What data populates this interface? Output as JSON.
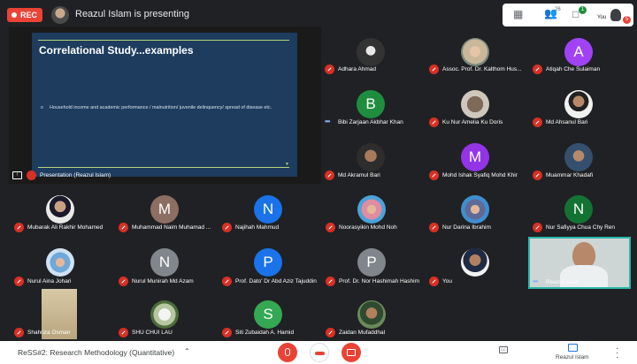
{
  "topbar": {
    "rec_label": "REC",
    "presenting_text": "Reazul Islam is presenting",
    "participants_count": "26",
    "chat_badge": "1",
    "you_label": "You",
    "alert_badge": "5"
  },
  "presentation": {
    "slide_title": "Correlational Study...examples",
    "slide_bullet": "o",
    "slide_body": "Household income and academic performance / malnutrition/ juvenile delinquency/ spread of disease etc.",
    "label": "Presentation (Reazul Islam)"
  },
  "participants": [
    {
      "name": "Adhara Ahmad"
    },
    {
      "name": "Assoc. Prof. Dr. Kalthom Hus..."
    },
    {
      "name": "Atiqah Che Sulaiman",
      "initial": "A"
    },
    {
      "name": "Bibi Zarjaan Akbhar Khan",
      "initial": "B"
    },
    {
      "name": "Ku Nur Amelia Ku Doris"
    },
    {
      "name": "Md Ahsanul Bari"
    },
    {
      "name": "Md Akramul Bari"
    },
    {
      "name": "Mohd Ishak Syafiq Mohd Khir",
      "initial": "M"
    },
    {
      "name": "Muammar Khadafi"
    },
    {
      "name": "Mubarak Ali Rakhir Mohamed"
    },
    {
      "name": "Muhammad Naim Muhamad ...",
      "initial": "M"
    },
    {
      "name": "Najihah Mahmud",
      "initial": "N"
    },
    {
      "name": "Noorasyikin Mohd Noh"
    },
    {
      "name": "Nur Darina Ibrahim"
    },
    {
      "name": "Nur Safiyya Chua Chy Ren",
      "initial": "N"
    },
    {
      "name": "Nurul Aina Johari"
    },
    {
      "name": "Nurul Munirah Md Azam",
      "initial": "N"
    },
    {
      "name": "Prof. Dato' Dr Abd Aziz Tajuddin",
      "initial": "P"
    },
    {
      "name": "Prof. Dr. Nor Hashimah Hashim",
      "initial": "P"
    },
    {
      "name": "You"
    },
    {
      "name": "Reazul Islam"
    },
    {
      "name": "Shahriza Osman"
    },
    {
      "name": "SHU CHUI LAU"
    },
    {
      "name": "Siti Zubaidah A. Hamid",
      "initial": "S"
    },
    {
      "name": "Zaidan Mufaddhal"
    }
  ],
  "colors": {
    "mic_off": "#d93025",
    "avatar_A": "#8e44c9",
    "avatar_B": "#1e8e3e",
    "avatar_M_purple": "#9334e6",
    "avatar_M_brown": "#8d6e63",
    "avatar_N_blue": "#1a73e8",
    "avatar_N_green": "#137333",
    "avatar_N_gray": "#80868b",
    "avatar_P_blue": "#1a73e8",
    "avatar_P_gray": "#80868b",
    "avatar_S": "#34a853",
    "highlight_border": "#2ab7a9"
  },
  "bottombar": {
    "meeting_title": "ReSS#2: Research Methodology (Quantitative)",
    "present_label": "Reazul Islam"
  }
}
